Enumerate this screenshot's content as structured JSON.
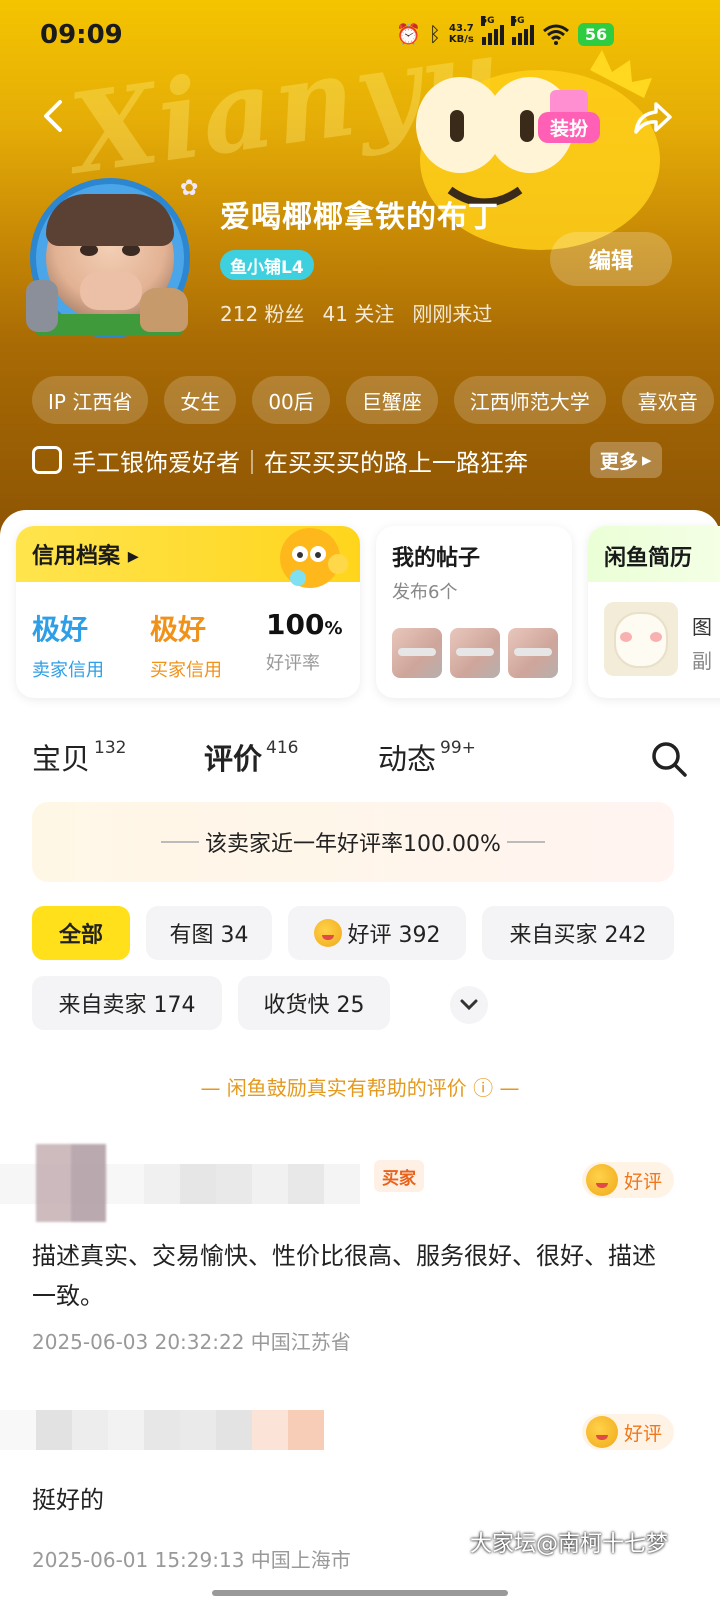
{
  "status": {
    "time": "09:09",
    "net_speed": "43.7",
    "net_unit": "KB/s",
    "signal1": "5G",
    "signal2": "5G",
    "battery": "56"
  },
  "header": {
    "dressup_label": "装扮",
    "nickname": "爱喝椰椰拿铁的布丁",
    "level_badge": "鱼小铺L4",
    "fans": "212 粉丝",
    "follows": "41 关注",
    "last_seen": "刚刚来过",
    "edit_label": "编辑",
    "tags": [
      "IP 江西省",
      "女生",
      "00后",
      "巨蟹座",
      "江西师范大学",
      "喜欢音"
    ],
    "bio": "手工银饰爱好者｜在买买买的路上一路狂奔",
    "more_label": "更多"
  },
  "cards": {
    "credit": {
      "title": "信用档案",
      "seller_value": "极好",
      "seller_label": "卖家信用",
      "buyer_value": "极好",
      "buyer_label": "买家信用",
      "good_rate_value": "100",
      "good_rate_unit": "%",
      "good_rate_label": "好评率",
      "colors": {
        "seller": "#2e9fe6",
        "buyer": "#f0921a"
      }
    },
    "posts": {
      "title": "我的帖子",
      "subtitle": "发布6个"
    },
    "resume": {
      "title": "闲鱼简历",
      "line1": "图",
      "line2": "副"
    }
  },
  "tabs": [
    {
      "label": "宝贝",
      "count": "132"
    },
    {
      "label": "评价",
      "count": "416"
    },
    {
      "label": "动态",
      "count": "99+"
    }
  ],
  "banner": "该卖家近一年好评率100.00%",
  "filters": [
    {
      "label": "全部",
      "active": true
    },
    {
      "label": "有图 34"
    },
    {
      "label": "好评 392",
      "icon": "smile-emoji-icon"
    },
    {
      "label": "来自买家 242"
    },
    {
      "label": "来自卖家 174"
    },
    {
      "label": "收货快 25"
    }
  ],
  "encourage": "— 闲鱼鼓励真实有帮助的评价 ⓘ —",
  "reviews": [
    {
      "role": "买家",
      "rating": "好评",
      "text": "描述真实、交易愉快、性价比很高、服务很好、很好、描述一致。",
      "time": "2025-06-03 20:32:22",
      "location": "中国江苏省"
    },
    {
      "role": "",
      "rating": "好评",
      "text": "挺好的",
      "time": "2025-06-01 15:29:13",
      "location": "中国上海市"
    }
  ],
  "watermark": "大家坛@南柯十七梦",
  "accent": "#ffe01a"
}
